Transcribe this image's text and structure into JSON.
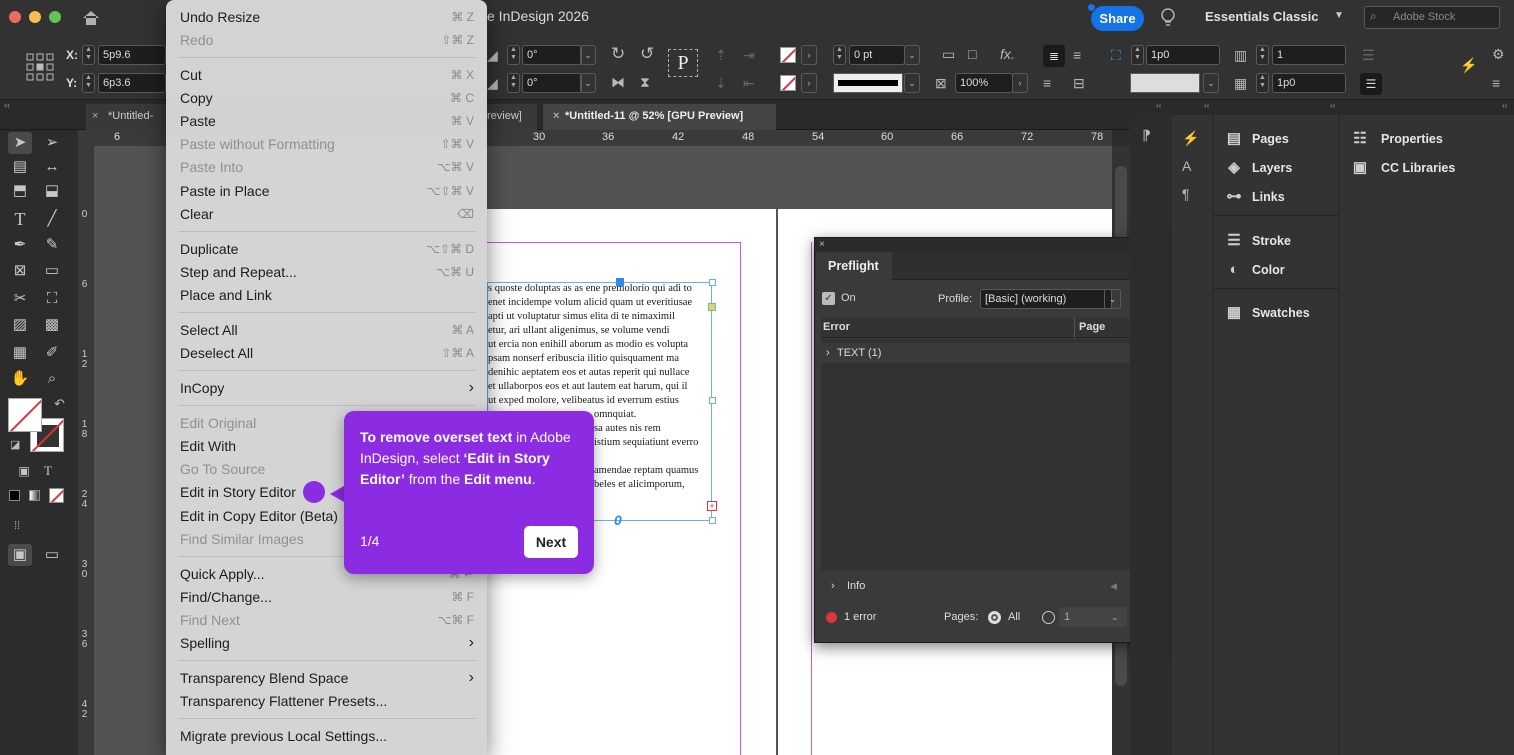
{
  "window": {
    "title": "e InDesign 2026",
    "share_label": "Share",
    "workspace": "Essentials Classic",
    "search_placeholder": "Adobe Stock"
  },
  "control_bar": {
    "x_label": "X:",
    "x_value": "5p9.6",
    "y_label": "Y:",
    "y_value": "6p3.6",
    "angle1": "0°",
    "angle2": "0°",
    "stroke_weight": "0 pt",
    "opacity": "100%",
    "gutter": "1p0",
    "columns": "1",
    "spacing": "1p0",
    "p_label": "P",
    "fx_label": "fx."
  },
  "tabs": [
    {
      "label": "*Untitled-",
      "close": "×"
    },
    {
      "label": "review]",
      "close": ""
    },
    {
      "label": "*Untitled-11 @ 52% [GPU Preview]",
      "close": "×"
    }
  ],
  "ruler_h": [
    "6",
    "30",
    "36",
    "42",
    "48",
    "54",
    "60",
    "66",
    "72",
    "78"
  ],
  "ruler_v": [
    "0",
    "6",
    "12",
    "18",
    "24",
    "30",
    "36",
    "42"
  ],
  "edit_menu": [
    {
      "label": "Undo Resize",
      "shortcut": "⌘ Z",
      "disabled": false
    },
    {
      "label": "Redo",
      "shortcut": "⇧⌘ Z",
      "disabled": true
    },
    {
      "label": "Cut",
      "shortcut": "⌘ X",
      "disabled": false
    },
    {
      "label": "Copy",
      "shortcut": "⌘ C",
      "disabled": false
    },
    {
      "label": "Paste",
      "shortcut": "⌘ V",
      "disabled": false
    },
    {
      "label": "Paste without Formatting",
      "shortcut": "⇧⌘ V",
      "disabled": true
    },
    {
      "label": "Paste Into",
      "shortcut": "⌥⌘ V",
      "disabled": true
    },
    {
      "label": "Paste in Place",
      "shortcut": "⌥⇧⌘ V",
      "disabled": false
    },
    {
      "label": "Clear",
      "shortcut": "⌫",
      "disabled": false
    },
    {
      "label": "Duplicate",
      "shortcut": "⌥⇧⌘ D",
      "disabled": false
    },
    {
      "label": "Step and Repeat...",
      "shortcut": "⌥⌘ U",
      "disabled": false
    },
    {
      "label": "Place and Link",
      "shortcut": "",
      "disabled": false
    },
    {
      "label": "Select All",
      "shortcut": "⌘ A",
      "disabled": false
    },
    {
      "label": "Deselect All",
      "shortcut": "⇧⌘ A",
      "disabled": false
    },
    {
      "label": "InCopy",
      "shortcut": "",
      "disabled": false
    },
    {
      "label": "Edit Original",
      "shortcut": "",
      "disabled": true
    },
    {
      "label": "Edit With",
      "shortcut": "",
      "disabled": false
    },
    {
      "label": "Go To Source",
      "shortcut": "",
      "disabled": true
    },
    {
      "label": "Edit in Story Editor",
      "shortcut": "",
      "disabled": false
    },
    {
      "label": "Edit in Copy Editor (Beta)",
      "shortcut": "",
      "disabled": false
    },
    {
      "label": "Find Similar Images",
      "shortcut": "",
      "disabled": true
    },
    {
      "label": "Quick Apply...",
      "shortcut": "⌘ ↩",
      "disabled": false
    },
    {
      "label": "Find/Change...",
      "shortcut": "⌘ F",
      "disabled": false
    },
    {
      "label": "Find Next",
      "shortcut": "⌥⌘ F",
      "disabled": true
    },
    {
      "label": "Spelling",
      "shortcut": "",
      "disabled": false
    },
    {
      "label": "Transparency Blend Space",
      "shortcut": "",
      "disabled": false
    },
    {
      "label": "Transparency Flattener Presets...",
      "shortcut": "",
      "disabled": false
    },
    {
      "label": "Migrate previous Local Settings...",
      "shortcut": "",
      "disabled": false
    }
  ],
  "tooltip": {
    "bold1": "To remove overset text",
    "text1": " in Adobe InDesign, select ",
    "bold2": "‘Edit in Story Editor’",
    "text2": " from the ",
    "bold3": "Edit menu",
    "text3": ".",
    "step": "1/4",
    "next_label": "Next"
  },
  "document_text": [
    "s quoste doluptas as as ene premolorio qui adi to",
    "enet incidempe volum alicid quam ut everitiusae",
    "apti ut voluptatur simus elita di te nimaximil",
    "etur, ari ullant aligenimus, se volume vendi",
    "ut ercia non enihill aborum as modio es volupta",
    "psam nonserf eribuscia ilitio quisquament ma",
    "denihic aeptatem eos et autas reperit qui nullace",
    "et ullaborpos eos et aut lautem eat harum, qui il",
    "ut exped molore, velibeatus id everrum estius",
    "omnquiat.",
    "sa autes nis rem",
    "istium sequiatiunt everro",
    "amendae reptam quamus",
    "beles et alicimporum,"
  ],
  "preflight": {
    "title": "Preflight",
    "on_label": "On",
    "profile_label": "Profile:",
    "profile_value": "[Basic] (working)",
    "col_error": "Error",
    "col_page": "Page",
    "row1": "TEXT (1)",
    "info_label": "Info",
    "errors": "1 error",
    "pages_label": "Pages:",
    "all_label": "All",
    "page_value": "1"
  },
  "panels_mid": [
    {
      "label": "Pages",
      "icon": "pages-icon"
    },
    {
      "label": "Layers",
      "icon": "layers-icon"
    },
    {
      "label": "Links",
      "icon": "links-icon"
    },
    {
      "label": "Stroke",
      "icon": "stroke-icon"
    },
    {
      "label": "Color",
      "icon": "color-icon"
    },
    {
      "label": "Swatches",
      "icon": "swatches-icon"
    }
  ],
  "panels_right": [
    {
      "label": "Properties",
      "icon": "properties-icon"
    },
    {
      "label": "CC Libraries",
      "icon": "cc-libraries-icon"
    }
  ],
  "colors": {
    "accent": "#8b2be2",
    "share_blue": "#1473e6",
    "error_red": "#e0333c"
  }
}
